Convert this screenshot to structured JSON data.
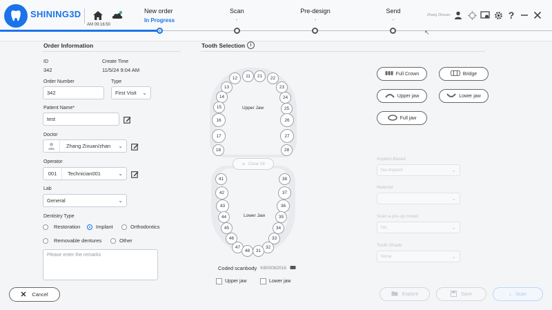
{
  "app": {
    "brand": "SHINING3D",
    "clock": "AM 09:16:50",
    "user_name": "Zhang Zhixuan",
    "accent": "#1a73e8"
  },
  "steps": [
    {
      "label": "New order",
      "status": "In Progress"
    },
    {
      "label": "Scan",
      "status": "-"
    },
    {
      "label": "Pre-design",
      "status": "-"
    },
    {
      "label": "Send",
      "status": "-"
    }
  ],
  "order": {
    "title": "Order Information",
    "id_label": "ID",
    "id_value": "342",
    "create_label": "Create Time",
    "create_value": "11/5/24 9:04 AM",
    "order_number_label": "Order Number",
    "order_number_value": "342",
    "type_label": "Type",
    "type_value": "First Visit",
    "patient_label": "Patient Name*",
    "patient_value": "test",
    "doctor_label": "Doctor",
    "doctor_value": "Zhang Zixuan/zhan",
    "operator_label": "Operator",
    "operator_code": "001",
    "operator_value": "Technician001",
    "lab_label": "Lab",
    "lab_value": "General",
    "dentistry_label": "Dentistry Type",
    "radio_restoration": "Restoration",
    "radio_implant": "Implant",
    "radio_orthodontics": "Orthodontics",
    "radio_removable": "Removable dentures",
    "radio_other": "Other",
    "remarks_placeholder": "Please enter the remarks"
  },
  "teeth": {
    "title": "Tooth Selection",
    "upper_label": "Upper Jaw",
    "lower_label": "Lower Jaw",
    "clear_all": "Clear All",
    "upper": [
      "11",
      "12",
      "13",
      "14",
      "15",
      "16",
      "17",
      "18",
      "21",
      "22",
      "23",
      "24",
      "25",
      "26",
      "27",
      "28"
    ],
    "lower": [
      "31",
      "32",
      "33",
      "34",
      "35",
      "36",
      "37",
      "38",
      "41",
      "42",
      "43",
      "44",
      "45",
      "46",
      "47",
      "48"
    ],
    "coded_label": "Coded scanbody",
    "coded_value": "KB00082016",
    "check_upper": "Upper jaw",
    "check_lower": "Lower jaw"
  },
  "restoration_buttons": {
    "full_crown": "Full Crown",
    "bridge": "Bridge",
    "upper_jaw": "Upper jaw",
    "lower_jaw": "Lower jaw",
    "full_jaw": "Full jaw"
  },
  "implant_form": {
    "implant_label": "Implant-Based",
    "implant_value": "No-implant",
    "material_label": "Material",
    "material_value": "",
    "preop_label": "Scan a pre-op model",
    "preop_value": "No",
    "shade_label": "Tooth Shade",
    "shade_value": "None"
  },
  "footer": {
    "cancel": "Cancel",
    "explore": "Explore",
    "save": "Save",
    "scan": "Scan"
  }
}
